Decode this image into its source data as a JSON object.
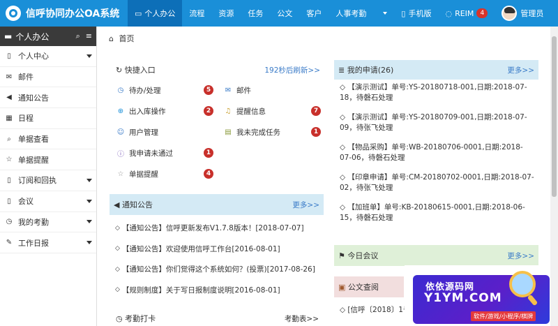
{
  "brand": {
    "title": "信呼协同办公OA系统"
  },
  "nav": [
    {
      "label": "个人办公",
      "icon": "desktop-icon",
      "active": true
    },
    {
      "label": "流程"
    },
    {
      "label": "资源"
    },
    {
      "label": "任务"
    },
    {
      "label": "公文"
    },
    {
      "label": "客户"
    },
    {
      "label": "人事考勤"
    }
  ],
  "nav_right": {
    "mobile": "手机版",
    "reim": "REIM",
    "reim_badge": "4",
    "user": "管理员"
  },
  "sidebar": {
    "title": "个人办公",
    "items": [
      {
        "label": "个人中心",
        "icon": "bookmark-icon",
        "caret": true
      },
      {
        "label": "邮件",
        "icon": "envelope-icon"
      },
      {
        "label": "通知公告",
        "icon": "volume-icon"
      },
      {
        "label": "日程",
        "icon": "calendar-icon"
      },
      {
        "label": "单据查看",
        "icon": "search-icon"
      },
      {
        "label": "单据提醒",
        "icon": "star-icon"
      },
      {
        "label": "订阅和回执",
        "icon": "bookmark-icon",
        "caret": true
      },
      {
        "label": "会议",
        "icon": "bookmark-icon",
        "caret": true
      },
      {
        "label": "我的考勤",
        "icon": "clock-icon",
        "caret": true
      },
      {
        "label": "工作日报",
        "icon": "edit-icon",
        "caret": true
      }
    ]
  },
  "breadcrumb": {
    "home": "首页"
  },
  "quick": {
    "title": "快捷入口",
    "refresh": "192秒后刷新>>",
    "items": [
      {
        "label": "待办/处理",
        "badge": "5",
        "icon": "clock-icon",
        "col": 0,
        "row": 0
      },
      {
        "label": "邮件",
        "badge": "",
        "icon": "envelope-icon",
        "col": 1,
        "row": 0
      },
      {
        "label": "出入库操作",
        "badge": "2",
        "icon": "plus-circle-icon",
        "col": 0,
        "row": 1
      },
      {
        "label": "提醒信息",
        "badge": "7",
        "icon": "bell-icon",
        "col": 1,
        "row": 1
      },
      {
        "label": "用户管理",
        "badge": "",
        "icon": "user-icon",
        "col": 0,
        "row": 2
      },
      {
        "label": "我未完成任务",
        "badge": "1",
        "icon": "tasks-icon",
        "col": 1,
        "row": 2
      },
      {
        "label": "我申请未通过",
        "badge": "1",
        "icon": "info-circle-icon",
        "col": 0,
        "row": 3
      },
      {
        "label": "单据提醒",
        "badge": "4",
        "icon": "star-icon",
        "col": 0,
        "row": 4
      }
    ]
  },
  "notice": {
    "title": "通知公告",
    "more": "更多>>",
    "items": [
      "【通知公告】信呼更新发布V1.7.8版本！[2018-07-07]",
      "【通知公告】欢迎使用信呼工作台[2016-08-01]",
      "【通知公告】你们觉得这个系统如何？(投票)[2017-08-26]",
      "【规则制度】关于写日报制度说明[2016-08-01]"
    ]
  },
  "attend": {
    "title": "考勤打卡",
    "more": "考勤表>>"
  },
  "apply": {
    "title": "我的申请(26)",
    "more": "更多>>",
    "items": [
      "【演示测试】单号:YS-20180718-001,日期:2018-07-18，待磐石处理",
      "【演示测试】单号:YS-20180709-001,日期:2018-07-09，待张飞处理",
      "【物品采购】单号:WB-20180706-0001,日期:2018-07-06，待磐石处理",
      "【印章申请】单号:CM-20180702-0001,日期:2018-07-02，待张飞处理",
      "【加班单】单号:KB-20180615-0001,日期:2018-06-15，待磐石处理"
    ]
  },
  "meeting": {
    "title": "今日会议",
    "more": "更多>>"
  },
  "docs": {
    "title": "公文查阅",
    "item": "[信呼〔2018〕1号"
  },
  "watermark": {
    "line1": "依依源码网",
    "line2": "Y1YM.COM",
    "line3": "软件/游戏/小程序/棋牌"
  }
}
